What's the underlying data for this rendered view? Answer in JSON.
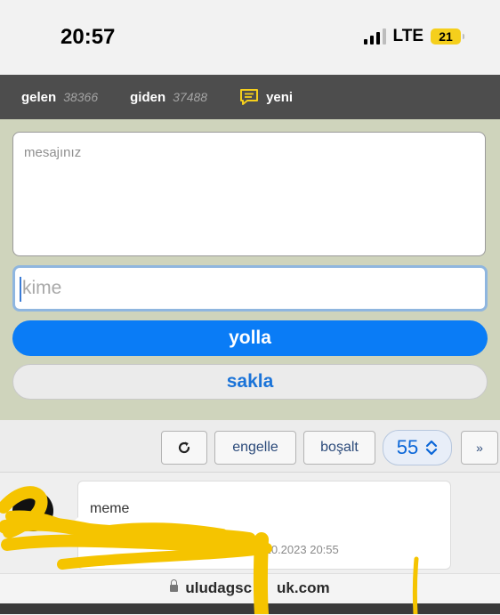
{
  "status_bar": {
    "time": "20:57",
    "network": "LTE",
    "battery": "21",
    "colors": {
      "battery_fill": "#f5cf1c"
    }
  },
  "nav": {
    "inbox_label": "gelen",
    "inbox_count": "38366",
    "outbox_label": "giden",
    "outbox_count": "37488",
    "new_label": "yeni",
    "new_icon": "chat-bubble-icon"
  },
  "compose": {
    "message_placeholder": "mesajınız",
    "to_placeholder": "kime",
    "send_label": "yolla",
    "save_label": "sakla",
    "colors": {
      "background": "#cfd4bc",
      "send": "#0a7cf6"
    }
  },
  "toolbar": {
    "refresh_icon": "refresh-icon",
    "block_label": "engelle",
    "empty_label": "boşalt",
    "page_value": "55",
    "next_label": "»"
  },
  "messages": [
    {
      "text": "meme",
      "timestamp": ".10.2023 20:55"
    }
  ],
  "address_bar": {
    "url": "uludagsc",
    "url_end": "uk.com"
  }
}
